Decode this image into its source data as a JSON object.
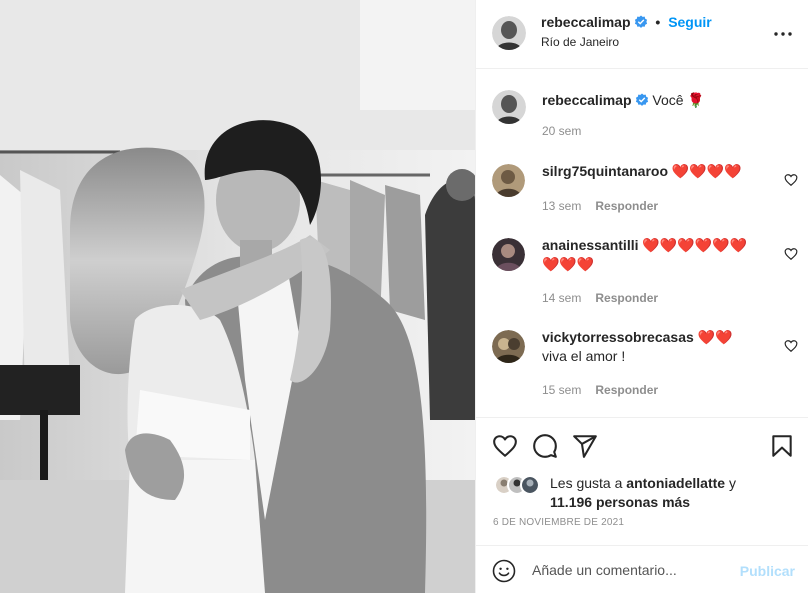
{
  "post": {
    "author": "rebeccalimap",
    "location": "Río de Janeiro",
    "follow_label": "Seguir",
    "separator": "•",
    "caption_text": "Você 🌹",
    "caption_time": "20 sem"
  },
  "comments": [
    {
      "user": "silrg75quintanaroo",
      "text": "❤️❤️❤️❤️",
      "time": "13 sem",
      "reply_label": "Responder"
    },
    {
      "user": "anainessantilli",
      "text": "❤️❤️❤️❤️❤️❤️❤️❤️❤️",
      "time": "14 sem",
      "reply_label": "Responder"
    },
    {
      "user": "vickytorressobrecasas",
      "text": "❤️❤️",
      "text2": "viva el amor !",
      "time": "15 sem",
      "reply_label": "Responder"
    }
  ],
  "likes": {
    "prefix": "Les gusta a",
    "user": "antoniadellatte",
    "connector": "y",
    "count_text": "11.196 personas más"
  },
  "date": "6 DE NOVIEMBRE DE 2021",
  "add_comment": {
    "placeholder": "Añade un comentario...",
    "publish_label": "Publicar"
  },
  "colors": {
    "link_blue": "#0095f6",
    "publish_disabled": "#b2dffc",
    "verified": "#3897f0",
    "secondary_text": "#8e8e8e"
  },
  "icons": [
    "verified-icon",
    "more-options-icon",
    "heart-icon",
    "comment-icon",
    "share-icon",
    "bookmark-icon",
    "emoji-icon"
  ]
}
